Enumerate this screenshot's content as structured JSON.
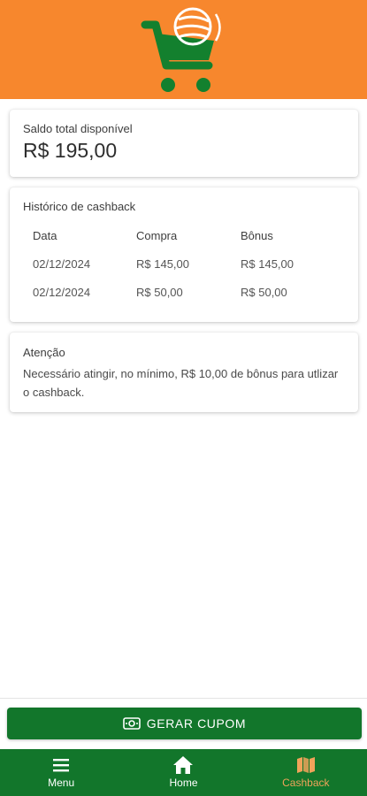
{
  "colors": {
    "header_bg": "#f7872d",
    "primary_green": "#12762b",
    "active_nav": "#f0a35a"
  },
  "header": {
    "logo_icon": "shopping-cart-globe-logo-icon"
  },
  "balance": {
    "label": "Saldo total disponível",
    "value": "R$ 195,00"
  },
  "history": {
    "title": "Histórico de cashback",
    "columns": [
      "Data",
      "Compra",
      "Bônus"
    ],
    "rows": [
      [
        "02/12/2024",
        "R$ 145,00",
        "R$ 145,00"
      ],
      [
        "02/12/2024",
        "R$ 50,00",
        "R$ 50,00"
      ]
    ]
  },
  "notice": {
    "title": "Atenção",
    "text": "Necessário atingir, no mínimo, R$ 10,00 de bônus para utlizar o cashback."
  },
  "coupon_button": {
    "label": "GERAR CUPOM",
    "icon": "cash-icon"
  },
  "nav": {
    "items": [
      {
        "label": "Menu",
        "icon": "menu-icon"
      },
      {
        "label": "Home",
        "icon": "home-icon"
      },
      {
        "label": "Cashback",
        "icon": "map-icon"
      }
    ],
    "active": "Cashback"
  }
}
